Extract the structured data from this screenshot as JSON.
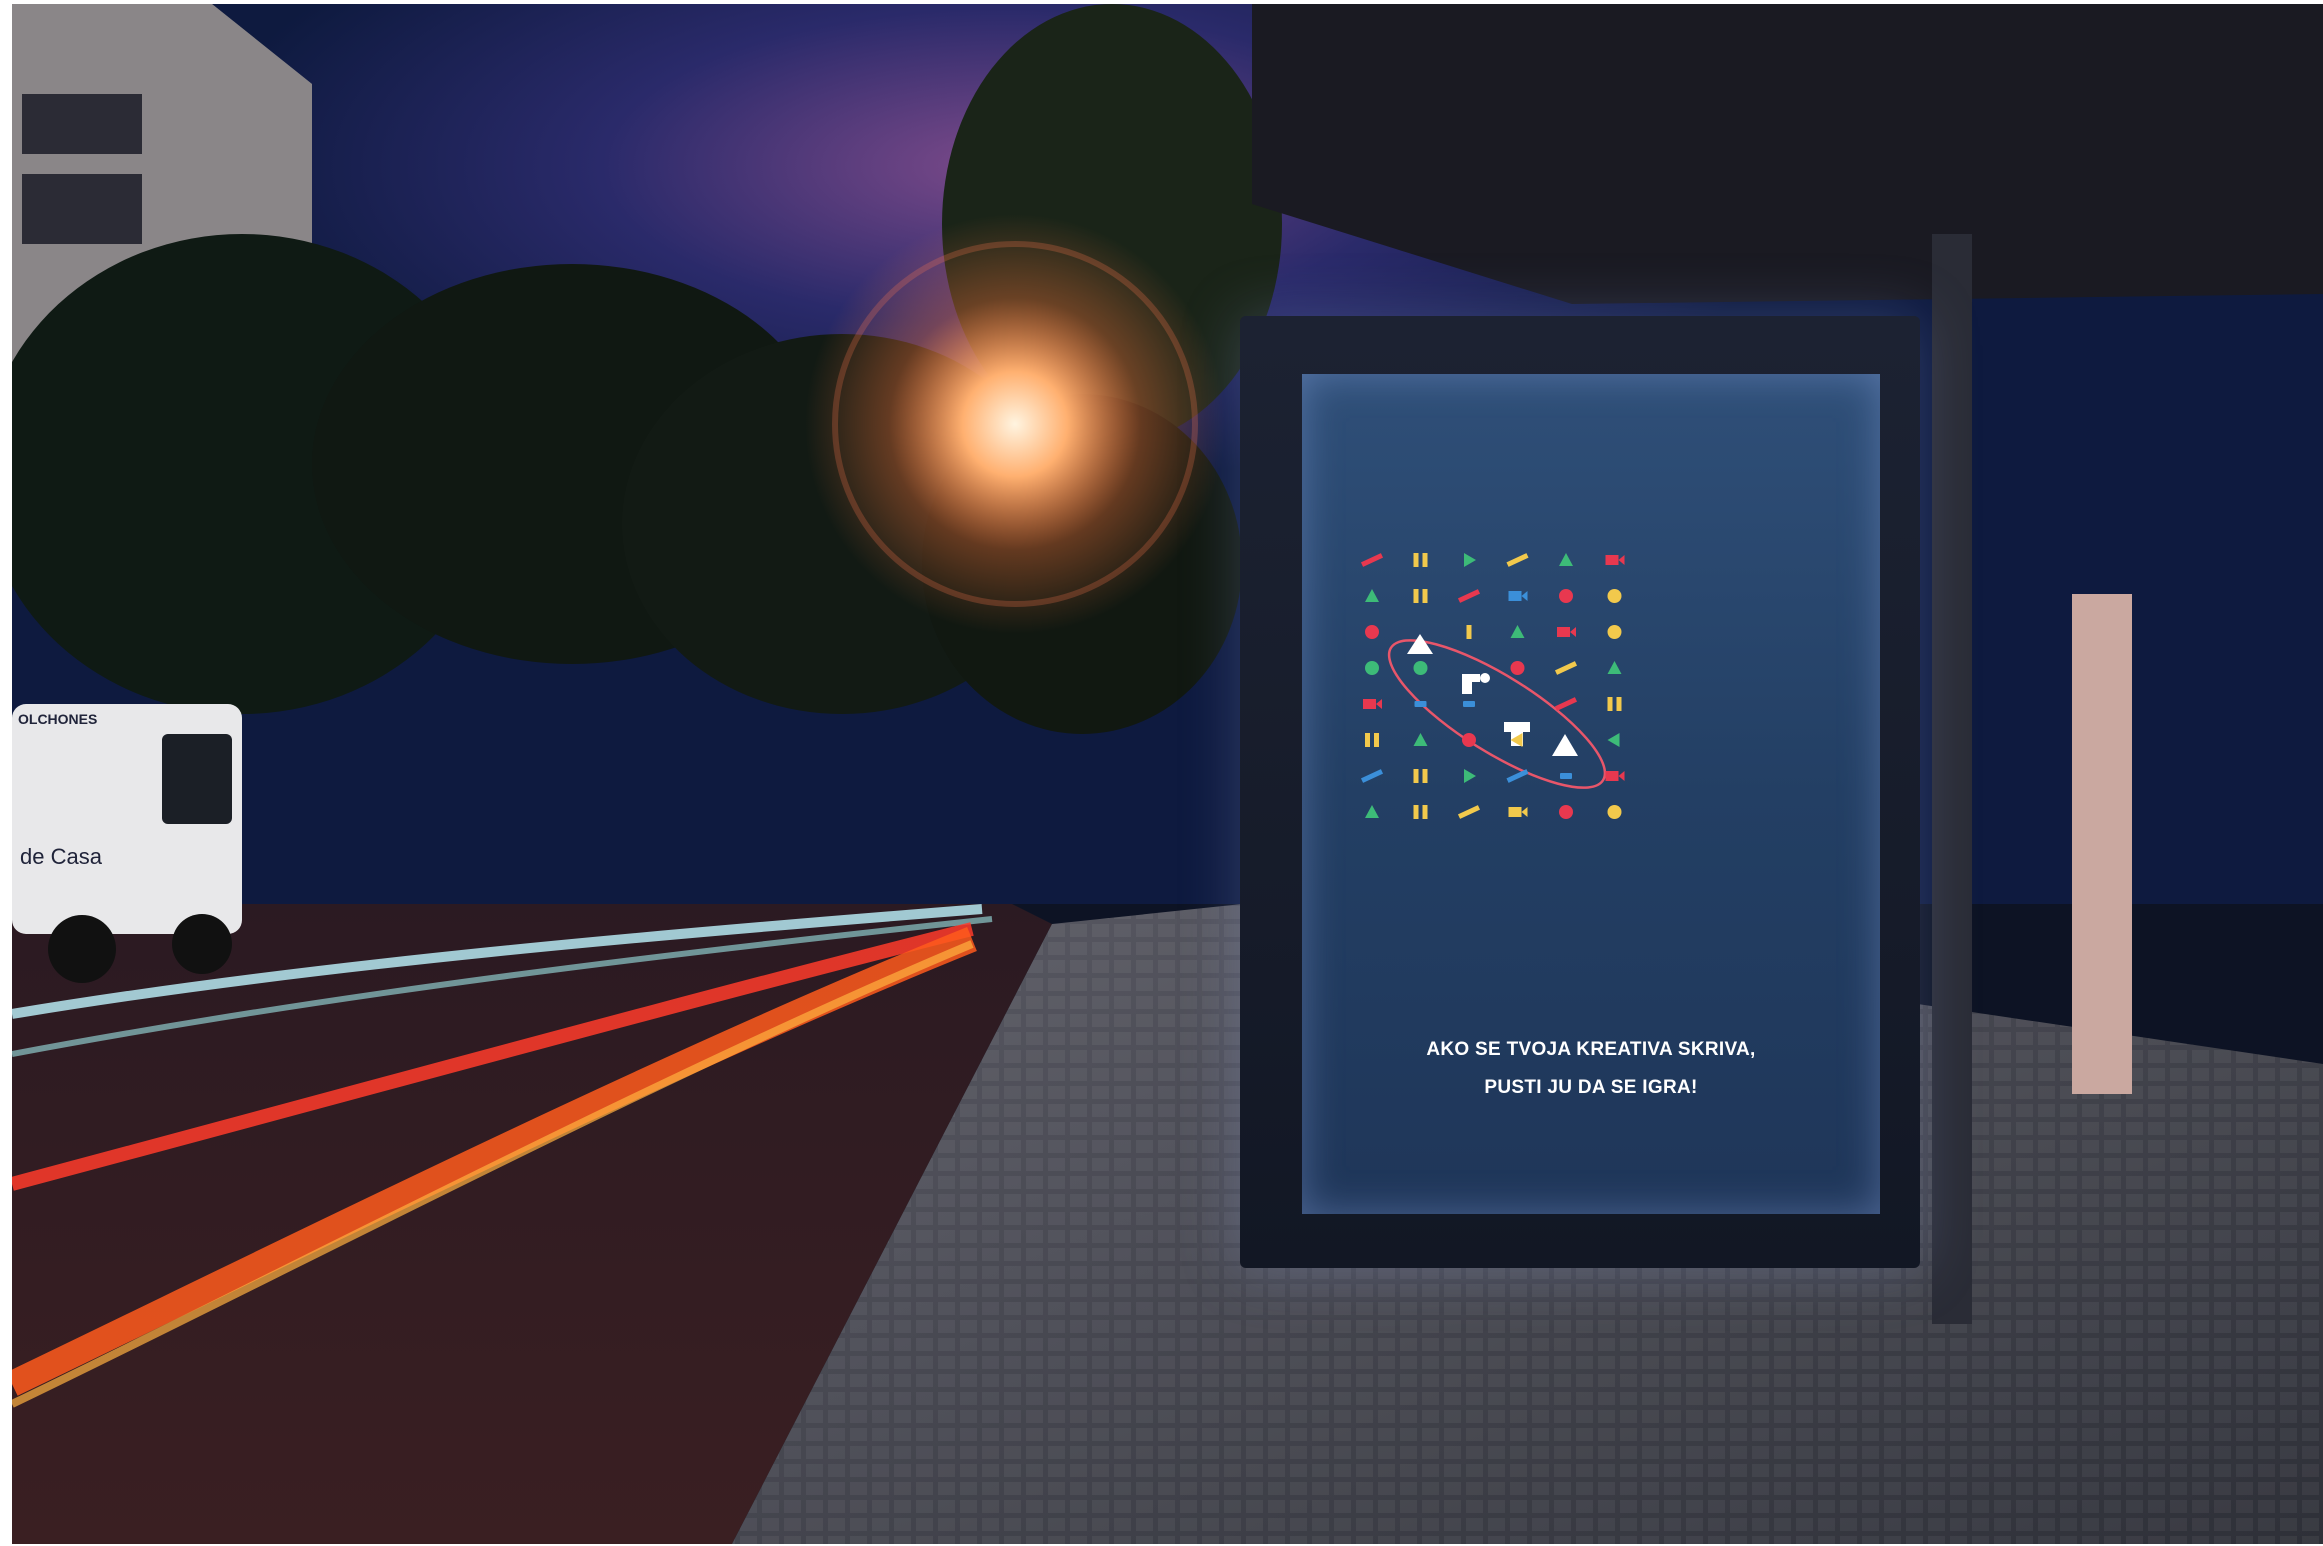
{
  "scene": {
    "description_free": true,
    "colors": {
      "sky": "#0e1a3f",
      "poster_bg": "#2a4770",
      "shape_red": "#e8384f",
      "shape_yellow": "#f2c94c",
      "shape_green": "#3dbb78",
      "shape_blue": "#3b8fd9",
      "ellipse": "#e8566a"
    }
  },
  "poster": {
    "slogan_line1": "AKO SE TVOJA KREATIVA SKRIVA,",
    "slogan_line2": "PUSTI JU DA SE IGRA!"
  },
  "van": {
    "text_top": "OLCHONES",
    "text_side": "de Casa"
  }
}
